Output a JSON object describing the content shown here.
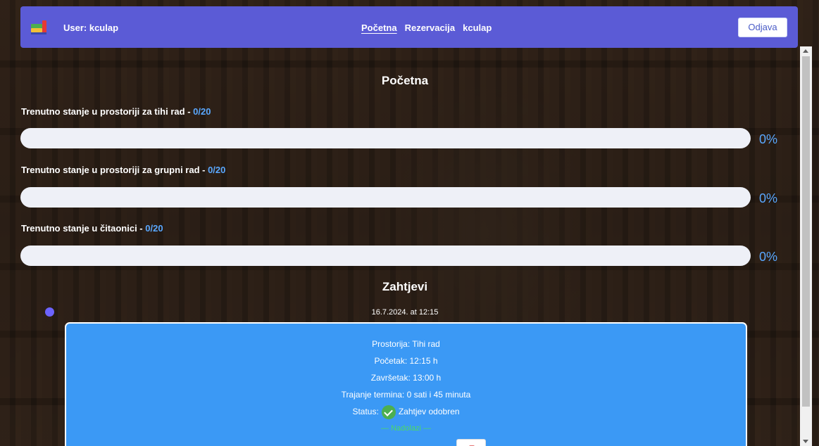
{
  "navbar": {
    "logo_icon": "books-logo-icon",
    "user_label": "User: kculap",
    "links": [
      "Početna",
      "Rezervacija",
      "kculap"
    ],
    "logout_label": "Odjava",
    "color": "#5b5bd6"
  },
  "main": {
    "title": "Početna",
    "rooms": [
      {
        "label": "Trenutno stanje u prostoriji za tihi rad - ",
        "count": "0/20",
        "percent": "0%",
        "fill": 0
      },
      {
        "label": "Trenutno stanje u prostoriji za grupni rad - ",
        "count": "0/20",
        "percent": "0%",
        "fill": 0
      },
      {
        "label": "Trenutno stanje u čitaonici - ",
        "count": "0/20",
        "percent": "0%",
        "fill": 0
      }
    ]
  },
  "requests": {
    "title": "Zahtjevi",
    "items": [
      {
        "date": "16.7.2024. at 12:15",
        "room": "Prostorija: Tihi rad",
        "start": "Početak: 12:15 h",
        "end": "Završetak: 13:00 h",
        "duration": "Trajanje termina: 0 sati i 45 minuta",
        "status_label": "Status:",
        "status_icon": "check-circle-icon",
        "status_text": "Zahtjev odobren",
        "place": "— Nadolazi —"
      }
    ]
  }
}
